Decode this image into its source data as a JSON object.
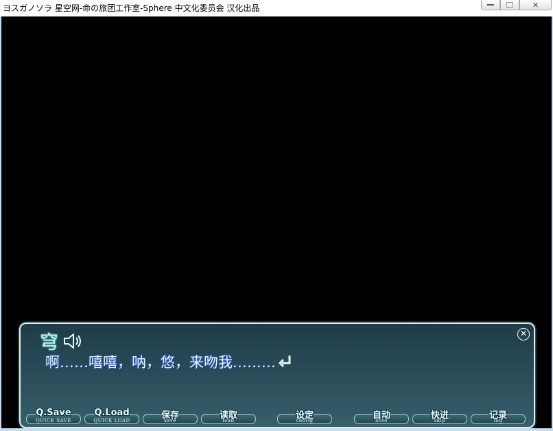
{
  "window": {
    "title": "ヨスガノソラ 星空网-命の旅团工作室-Sphere 中文化委员会 汉化出品",
    "minimize_label": "",
    "maximize_label": "",
    "close_label": "✕"
  },
  "message": {
    "speaker": "穹",
    "voice_icon": "speaker-icon",
    "text": "啊……嘻嘻，呐，悠，来吻我………",
    "close_label": "✕"
  },
  "menu": [
    {
      "id": "qsave",
      "label": "Q.Save",
      "sub": "QUICK SAVE"
    },
    {
      "id": "qload",
      "label": "Q.Load",
      "sub": "QUICK LOAD"
    },
    {
      "id": "save",
      "label": "保存",
      "sub": "save"
    },
    {
      "id": "load",
      "label": "读取",
      "sub": "load"
    },
    {
      "id": "config",
      "label": "设定",
      "sub": "config"
    },
    {
      "id": "auto",
      "label": "自动",
      "sub": "auto"
    },
    {
      "id": "skip",
      "label": "快进",
      "sub": "skip"
    },
    {
      "id": "log",
      "label": "记录",
      "sub": "log"
    }
  ]
}
